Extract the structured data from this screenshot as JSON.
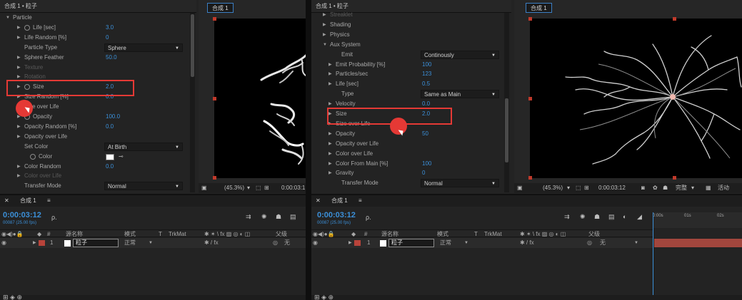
{
  "left": {
    "panel_title": "合成 1 • 粒子",
    "viewer_tab": "合成 1",
    "fx_rows": [
      {
        "label": "Particle",
        "value": "",
        "indent": 0,
        "arrow": "down",
        "dim": false
      },
      {
        "label": "Life [sec]",
        "value": "3.0",
        "indent": 2,
        "arrow": "right",
        "stopwatch": true,
        "dim": false
      },
      {
        "label": "Life Random [%]",
        "value": "0",
        "indent": 2,
        "arrow": "right",
        "dim": false
      },
      {
        "label": "Particle Type",
        "value": "",
        "dropdown": "Sphere",
        "indent": 2,
        "arrow": "none",
        "dim": false
      },
      {
        "label": "Sphere Feather",
        "value": "50.0",
        "indent": 2,
        "arrow": "right",
        "dim": false
      },
      {
        "label": "Texture",
        "value": "",
        "indent": 2,
        "arrow": "right",
        "dim": true
      },
      {
        "label": "Rotation",
        "value": "",
        "indent": 2,
        "arrow": "right",
        "dim": true
      },
      {
        "label": "Size",
        "value": "2.0",
        "indent": 2,
        "arrow": "right",
        "stopwatch": true,
        "dim": false
      },
      {
        "label": "Size Random [%]",
        "value": "0.0",
        "indent": 2,
        "arrow": "right",
        "dim": false
      },
      {
        "label": "Size over Life",
        "value": "",
        "indent": 2,
        "arrow": "right",
        "dim": false
      },
      {
        "label": "Opacity",
        "value": "100.0",
        "indent": 2,
        "arrow": "right",
        "stopwatch": true,
        "dim": false
      },
      {
        "label": "Opacity Random [%]",
        "value": "0.0",
        "indent": 2,
        "arrow": "right",
        "dim": false
      },
      {
        "label": "Opacity over Life",
        "value": "",
        "indent": 2,
        "arrow": "right",
        "dim": false
      },
      {
        "label": "Set Color",
        "value": "",
        "dropdown": "At Birth",
        "indent": 2,
        "arrow": "none",
        "dim": false
      },
      {
        "label": "Color",
        "value": "",
        "swatch": true,
        "indent": 3,
        "arrow": "none",
        "stopwatch": true,
        "dim": false
      },
      {
        "label": "Color Random",
        "value": "0.0",
        "indent": 2,
        "arrow": "right",
        "dim": false
      },
      {
        "label": "Color over Life",
        "value": "",
        "indent": 2,
        "arrow": "right",
        "dim": true
      },
      {
        "label": "Transfer Mode",
        "value": "",
        "dropdown": "Normal",
        "indent": 2,
        "arrow": "none",
        "dim": false
      }
    ],
    "viewer_footer": {
      "zoom": "(45.3%)",
      "timecode": "0:00:03:1"
    },
    "timeline": {
      "tab": "合成 1",
      "timecode": "0:00:03:12",
      "fps": "00087 (25.00 fps)",
      "search_placeholder": "ρ.",
      "headers": {
        "num": "#",
        "source_name": "源名称",
        "mode": "模式",
        "t": "T",
        "trkmat": "TrkMat",
        "parent": "父级"
      },
      "layer": {
        "num": "1",
        "name": "粒子",
        "mode": "正常",
        "parent": "无"
      }
    }
  },
  "right": {
    "panel_title": "合成 1 • 粒子",
    "viewer_tab": "合成 1",
    "fx_rows": [
      {
        "label": "Streaklet",
        "value": "",
        "indent": 1,
        "arrow": "right",
        "dim": true
      },
      {
        "label": "Shading",
        "value": "",
        "indent": 1,
        "arrow": "right",
        "dim": false
      },
      {
        "label": "Physics",
        "value": "",
        "indent": 1,
        "arrow": "right",
        "dim": false
      },
      {
        "label": "Aux System",
        "value": "",
        "indent": 1,
        "arrow": "down",
        "dim": false
      },
      {
        "label": "Emit",
        "value": "",
        "dropdown": "Continously",
        "indent": 3,
        "arrow": "none",
        "dim": false
      },
      {
        "label": "Emit Probability [%]",
        "value": "100",
        "indent": 2,
        "arrow": "right",
        "dim": false
      },
      {
        "label": "Particles/sec",
        "value": "123",
        "indent": 2,
        "arrow": "right",
        "dim": false
      },
      {
        "label": "Life [sec]",
        "value": "0.5",
        "indent": 2,
        "arrow": "right",
        "dim": false
      },
      {
        "label": "Type",
        "value": "",
        "dropdown": "Same as Main",
        "indent": 3,
        "arrow": "none",
        "dim": false
      },
      {
        "label": "Velocity",
        "value": "0.0",
        "indent": 2,
        "arrow": "right",
        "dim": false
      },
      {
        "label": "Size",
        "value": "2.0",
        "indent": 2,
        "arrow": "right",
        "dim": false
      },
      {
        "label": "Size over Life",
        "value": "",
        "indent": 2,
        "arrow": "right",
        "dim": false
      },
      {
        "label": "Opacity",
        "value": "50",
        "indent": 2,
        "arrow": "right",
        "dim": false
      },
      {
        "label": "Opacity over Life",
        "value": "",
        "indent": 2,
        "arrow": "right",
        "dim": false
      },
      {
        "label": "Color over Life",
        "value": "",
        "indent": 2,
        "arrow": "right",
        "dim": false
      },
      {
        "label": "Color From Main [%]",
        "value": "100",
        "indent": 2,
        "arrow": "right",
        "dim": false
      },
      {
        "label": "Gravity",
        "value": "0",
        "indent": 2,
        "arrow": "right",
        "dim": false
      },
      {
        "label": "Transfer Mode",
        "value": "",
        "dropdown": "Normal",
        "indent": 3,
        "arrow": "none",
        "dim": false
      }
    ],
    "viewer_footer": {
      "zoom": "(45.3%)",
      "timecode": "0:00:03:12",
      "quality": "完整",
      "active": "活动"
    },
    "timeline": {
      "tab": "合成 1",
      "timecode": "0:00:03:12",
      "fps": "00087 (25.00 fps)",
      "search_placeholder": "ρ.",
      "headers": {
        "num": "#",
        "source_name": "源名称",
        "mode": "模式",
        "t": "T",
        "trkmat": "TrkMat",
        "parent": "父级"
      },
      "layer": {
        "num": "1",
        "name": "粒子",
        "mode": "正常",
        "parent": "无"
      },
      "ruler_labels": [
        "0:00s",
        "01s",
        "02s"
      ]
    }
  },
  "colors": {
    "accent_blue": "#3b8fd8",
    "highlight_red": "#e53935",
    "layer_label": "#b8433a"
  }
}
